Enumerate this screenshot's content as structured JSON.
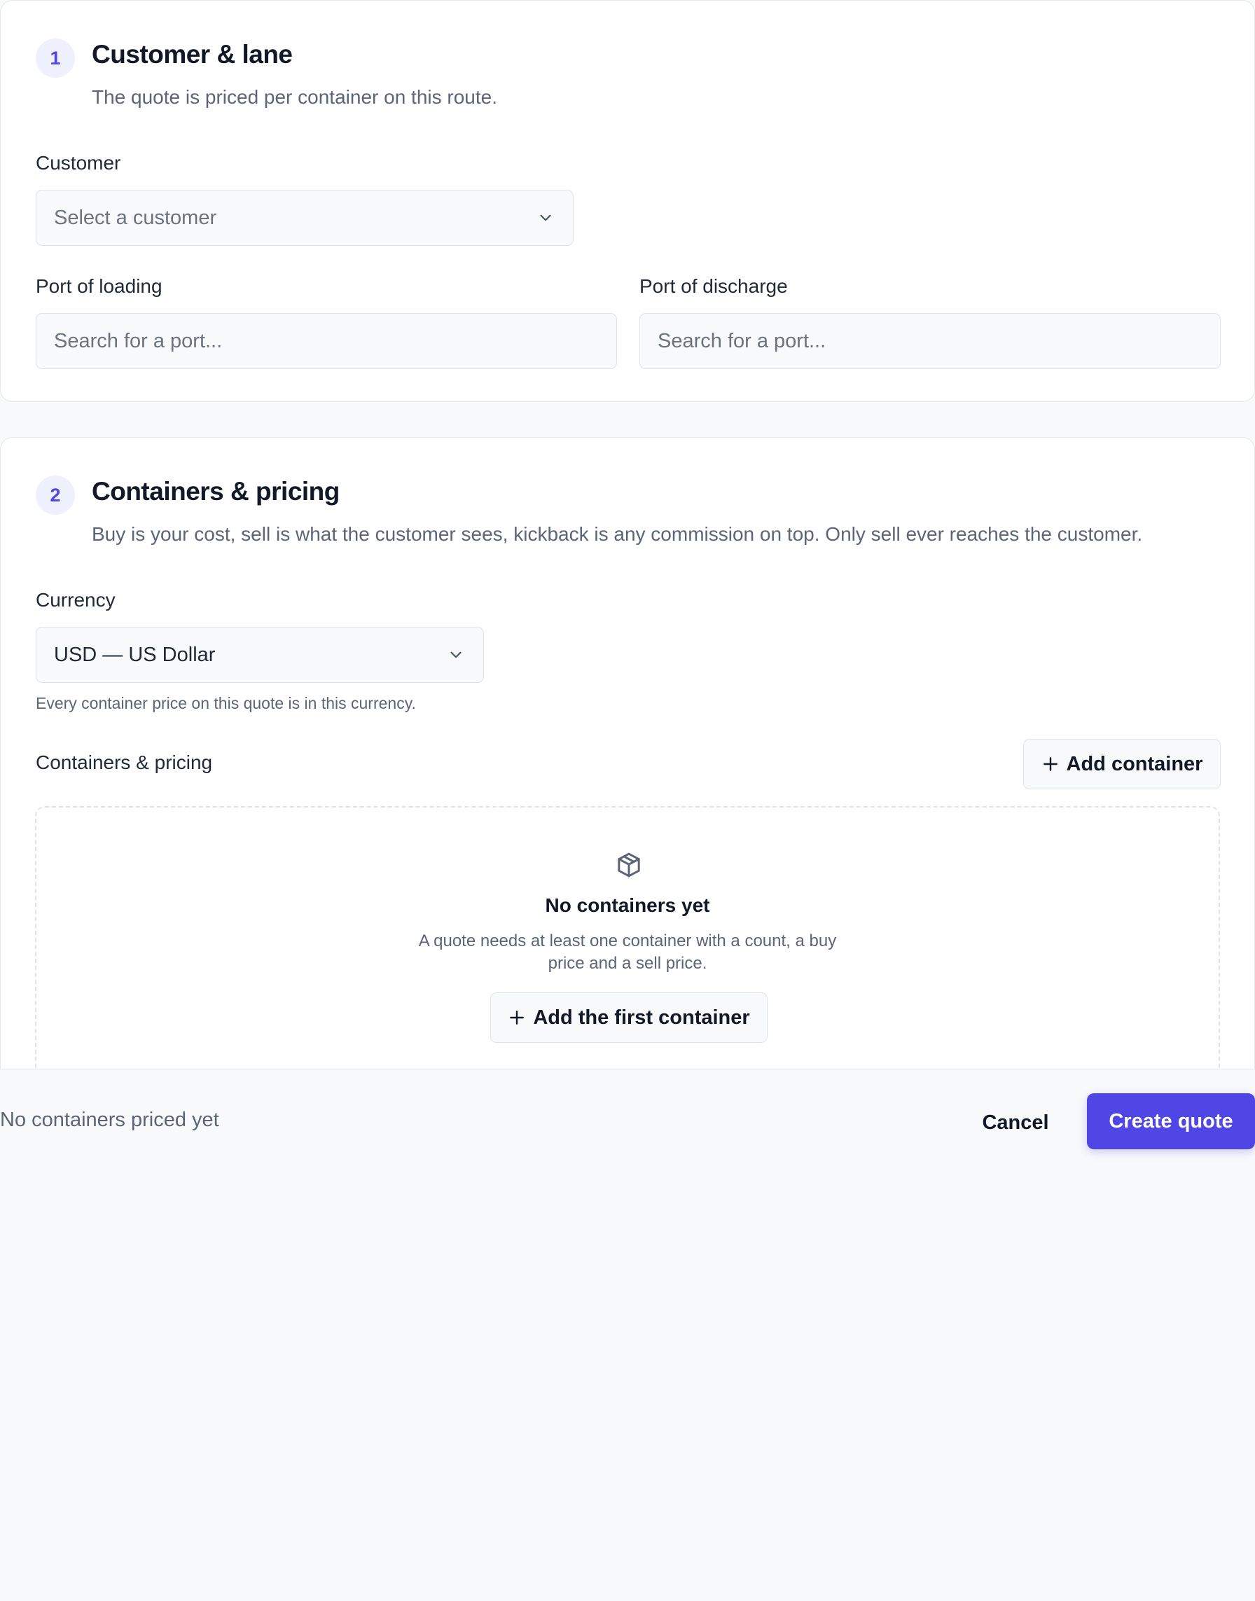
{
  "section1": {
    "step": "1",
    "title": "Customer & lane",
    "description": "The quote is priced per container on this route.",
    "customer": {
      "label": "Customer",
      "placeholder": "Select a customer"
    },
    "port_loading": {
      "label": "Port of loading",
      "placeholder": "Search for a port..."
    },
    "port_discharge": {
      "label": "Port of discharge",
      "placeholder": "Search for a port..."
    }
  },
  "section2": {
    "step": "2",
    "title": "Containers & pricing",
    "description": "Buy is your cost, sell is what the customer sees, kickback is any commission on top. Only sell ever reaches the customer.",
    "currency": {
      "label": "Currency",
      "value": "USD — US Dollar",
      "help": "Every container price on this quote is in this currency."
    },
    "containers_label": "Containers & pricing",
    "add_container_label": "Add container",
    "empty_state": {
      "icon": "package-icon",
      "title": "No containers yet",
      "text_line1": "A quote needs at least one container with a count, a buy",
      "text_line2": "price and a sell price.",
      "button_label": "Add the first container"
    }
  },
  "footer": {
    "status": "No containers priced yet",
    "cancel_label": "Cancel",
    "create_label": "Create quote"
  },
  "colors": {
    "accent": "#4f46e5",
    "badge_bg": "#eef0fd"
  }
}
